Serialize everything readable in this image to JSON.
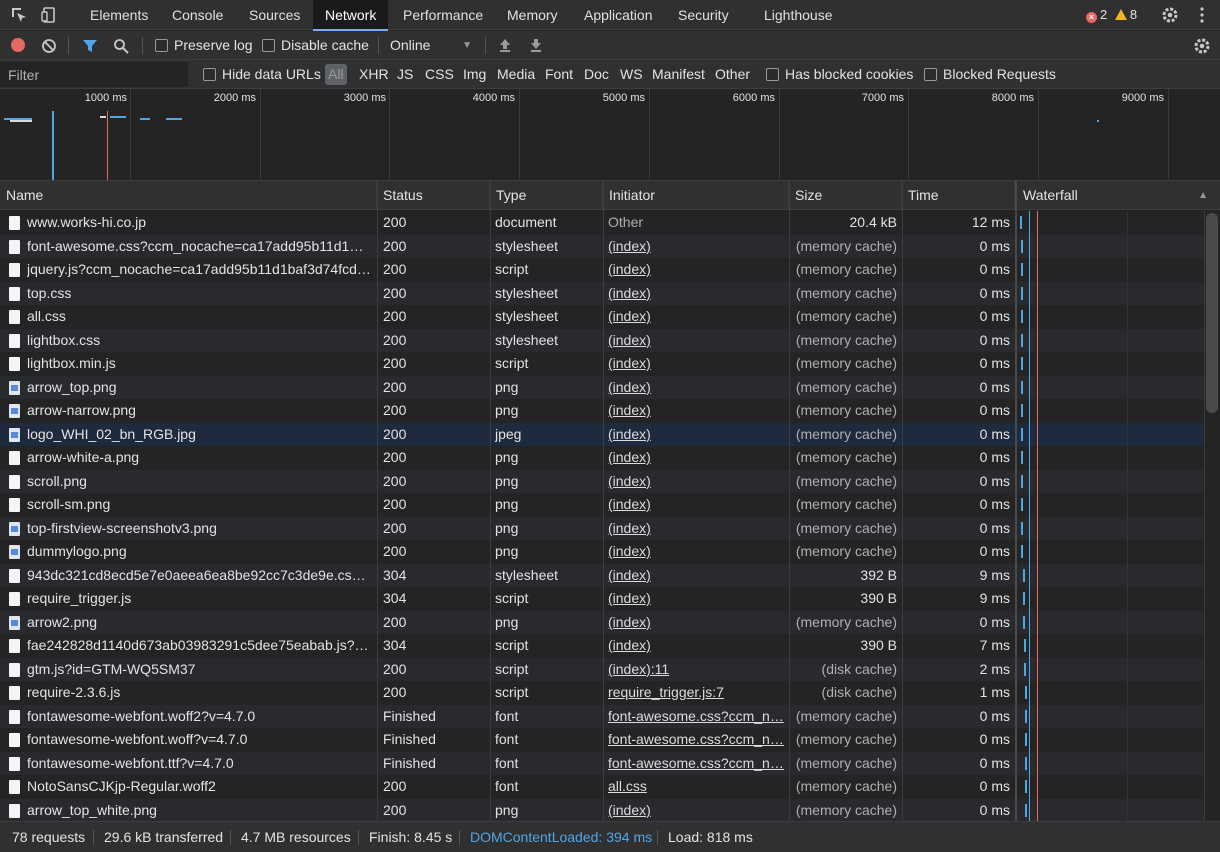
{
  "tabs": [
    "Elements",
    "Console",
    "Sources",
    "Network",
    "Performance",
    "Memory",
    "Application",
    "Security",
    "Lighthouse"
  ],
  "active_tab": "Network",
  "errors_count": "2",
  "warnings_count": "8",
  "toolbar": {
    "preserve_log": "Preserve log",
    "disable_cache": "Disable cache",
    "throttle": "Online"
  },
  "filterbar": {
    "filter_placeholder": "Filter",
    "hide_data_urls": "Hide data URLs",
    "types": [
      "All",
      "XHR",
      "JS",
      "CSS",
      "Img",
      "Media",
      "Font",
      "Doc",
      "WS",
      "Manifest",
      "Other"
    ],
    "has_blocked_cookies": "Has blocked cookies",
    "blocked_requests": "Blocked Requests"
  },
  "overview": {
    "ticks": [
      "1000 ms",
      "2000 ms",
      "3000 ms",
      "4000 ms",
      "5000 ms",
      "6000 ms",
      "7000 ms",
      "8000 ms",
      "9000 ms"
    ]
  },
  "columns": {
    "name": "Name",
    "status": "Status",
    "type": "Type",
    "initiator": "Initiator",
    "size": "Size",
    "time": "Time",
    "waterfall": "Waterfall"
  },
  "rows": [
    {
      "name": "www.works-hi.co.jp",
      "status": "200",
      "type": "document",
      "initiator": "Other",
      "size": "20.4 kB",
      "time": "12 ms",
      "icon": "document-icon"
    },
    {
      "name": "font-awesome.css?ccm_nocache=ca17add95b11d1b…",
      "status": "200",
      "type": "stylesheet",
      "initiator": "(index)",
      "size": "(memory cache)",
      "time": "0 ms",
      "icon": "document-icon"
    },
    {
      "name": "jquery.js?ccm_nocache=ca17add95b11d1baf3d74fcd3…",
      "status": "200",
      "type": "script",
      "initiator": "(index)",
      "size": "(memory cache)",
      "time": "0 ms",
      "icon": "document-icon"
    },
    {
      "name": "top.css",
      "status": "200",
      "type": "stylesheet",
      "initiator": "(index)",
      "size": "(memory cache)",
      "time": "0 ms",
      "icon": "document-icon"
    },
    {
      "name": "all.css",
      "status": "200",
      "type": "stylesheet",
      "initiator": "(index)",
      "size": "(memory cache)",
      "time": "0 ms",
      "icon": "document-icon"
    },
    {
      "name": "lightbox.css",
      "status": "200",
      "type": "stylesheet",
      "initiator": "(index)",
      "size": "(memory cache)",
      "time": "0 ms",
      "icon": "document-icon"
    },
    {
      "name": "lightbox.min.js",
      "status": "200",
      "type": "script",
      "initiator": "(index)",
      "size": "(memory cache)",
      "time": "0 ms",
      "icon": "document-icon"
    },
    {
      "name": "arrow_top.png",
      "status": "200",
      "type": "png",
      "initiator": "(index)",
      "size": "(memory cache)",
      "time": "0 ms",
      "icon": "image-icon"
    },
    {
      "name": "arrow-narrow.png",
      "status": "200",
      "type": "png",
      "initiator": "(index)",
      "size": "(memory cache)",
      "time": "0 ms",
      "icon": "image-icon"
    },
    {
      "name": "logo_WHI_02_bn_RGB.jpg",
      "status": "200",
      "type": "jpeg",
      "initiator": "(index)",
      "size": "(memory cache)",
      "time": "0 ms",
      "icon": "image-icon"
    },
    {
      "name": "arrow-white-a.png",
      "status": "200",
      "type": "png",
      "initiator": "(index)",
      "size": "(memory cache)",
      "time": "0 ms",
      "icon": "document-icon"
    },
    {
      "name": "scroll.png",
      "status": "200",
      "type": "png",
      "initiator": "(index)",
      "size": "(memory cache)",
      "time": "0 ms",
      "icon": "document-icon"
    },
    {
      "name": "scroll-sm.png",
      "status": "200",
      "type": "png",
      "initiator": "(index)",
      "size": "(memory cache)",
      "time": "0 ms",
      "icon": "document-icon"
    },
    {
      "name": "top-firstview-screenshotv3.png",
      "status": "200",
      "type": "png",
      "initiator": "(index)",
      "size": "(memory cache)",
      "time": "0 ms",
      "icon": "image-icon"
    },
    {
      "name": "dummylogo.png",
      "status": "200",
      "type": "png",
      "initiator": "(index)",
      "size": "(memory cache)",
      "time": "0 ms",
      "icon": "image-icon"
    },
    {
      "name": "943dc321cd8ecd5e7e0aeea6ea8be92cc7c3de9e.css?…",
      "status": "304",
      "type": "stylesheet",
      "initiator": "(index)",
      "size": "392 B",
      "time": "9 ms",
      "icon": "document-icon"
    },
    {
      "name": "require_trigger.js",
      "status": "304",
      "type": "script",
      "initiator": "(index)",
      "size": "390 B",
      "time": "9 ms",
      "icon": "document-icon"
    },
    {
      "name": "arrow2.png",
      "status": "200",
      "type": "png",
      "initiator": "(index)",
      "size": "(memory cache)",
      "time": "0 ms",
      "icon": "image-icon"
    },
    {
      "name": "fae242828d1140d673ab03983291c5dee75eabab.js?c…",
      "status": "304",
      "type": "script",
      "initiator": "(index)",
      "size": "390 B",
      "time": "7 ms",
      "icon": "document-icon"
    },
    {
      "name": "gtm.js?id=GTM-WQ5SM37",
      "status": "200",
      "type": "script",
      "initiator": "(index):11",
      "size": "(disk cache)",
      "time": "2 ms",
      "icon": "document-icon"
    },
    {
      "name": "require-2.3.6.js",
      "status": "200",
      "type": "script",
      "initiator": "require_trigger.js:7",
      "size": "(disk cache)",
      "time": "1 ms",
      "icon": "document-icon"
    },
    {
      "name": "fontawesome-webfont.woff2?v=4.7.0",
      "status": "Finished",
      "type": "font",
      "initiator": "font-awesome.css?ccm_n…",
      "size": "(memory cache)",
      "time": "0 ms",
      "icon": "document-icon"
    },
    {
      "name": "fontawesome-webfont.woff?v=4.7.0",
      "status": "Finished",
      "type": "font",
      "initiator": "font-awesome.css?ccm_n…",
      "size": "(memory cache)",
      "time": "0 ms",
      "icon": "document-icon"
    },
    {
      "name": "fontawesome-webfont.ttf?v=4.7.0",
      "status": "Finished",
      "type": "font",
      "initiator": "font-awesome.css?ccm_n…",
      "size": "(memory cache)",
      "time": "0 ms",
      "icon": "document-icon"
    },
    {
      "name": "NotoSansCJKjp-Regular.woff2",
      "status": "200",
      "type": "font",
      "initiator": "all.css",
      "size": "(memory cache)",
      "time": "0 ms",
      "icon": "document-icon"
    },
    {
      "name": "arrow_top_white.png",
      "status": "200",
      "type": "png",
      "initiator": "(index)",
      "size": "(memory cache)",
      "time": "0 ms",
      "icon": "document-icon"
    }
  ],
  "status": {
    "requests": "78 requests",
    "transferred": "29.6 kB transferred",
    "resources": "4.7 MB resources",
    "finish": "Finish: 8.45 s",
    "dom_content_loaded": "DOMContentLoaded: 394 ms",
    "load": "Load: 818 ms"
  },
  "colors": {
    "accent_blue": "#4fa6e6",
    "record_red": "#e46962",
    "load_line": "#e46962"
  }
}
